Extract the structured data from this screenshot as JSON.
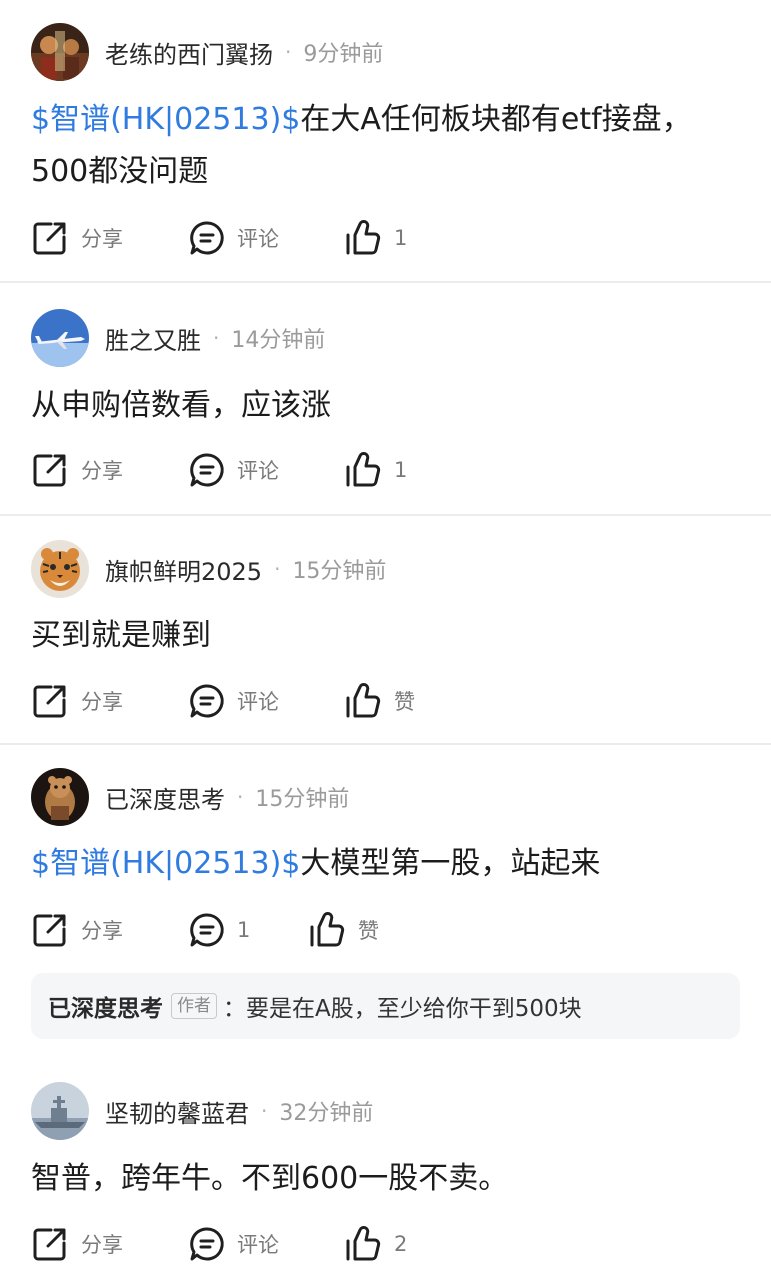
{
  "colors": {
    "link_blue": "#2f7be0",
    "muted": "#9a9a9a",
    "divider": "#ececec",
    "reply_bg": "#f5f6f8"
  },
  "labels": {
    "share": "分享",
    "comment": "评论",
    "like": "赞"
  },
  "icons": {
    "share": "share-icon",
    "comment": "comment-icon",
    "like": "thumbs-up-icon"
  },
  "posts": [
    {
      "username": "老练的西门翼扬",
      "time": "9分钟前",
      "tag": "$智谱(HK|02513)$",
      "text": "在大A任何板块都有etf接盘，",
      "text2": "500都没问题",
      "share": "分享",
      "comment": "评论",
      "like": "1"
    },
    {
      "username": "胜之又胜",
      "time": "14分钟前",
      "text": "从申购倍数看，应该涨",
      "share": "分享",
      "comment": "评论",
      "like": "1"
    },
    {
      "username": "旗帜鲜明2025",
      "time": "15分钟前",
      "text": "买到就是赚到",
      "share": "分享",
      "comment": "评论",
      "like": "赞"
    },
    {
      "username": "已深度思考",
      "time": "15分钟前",
      "tag": "$智谱(HK|02513)$",
      "text": "大模型第一股，站起来",
      "share": "分享",
      "comment": "1",
      "like": "赞",
      "reply": {
        "name": "已深度思考",
        "badge": "作者",
        "text": "：要是在A股，至少给你干到500块"
      }
    },
    {
      "username": "坚韧的馨蓝君",
      "time": "32分钟前",
      "text": "智普，跨年牛。不到600一股不卖。",
      "share": "分享",
      "comment": "评论",
      "like": "2"
    }
  ]
}
